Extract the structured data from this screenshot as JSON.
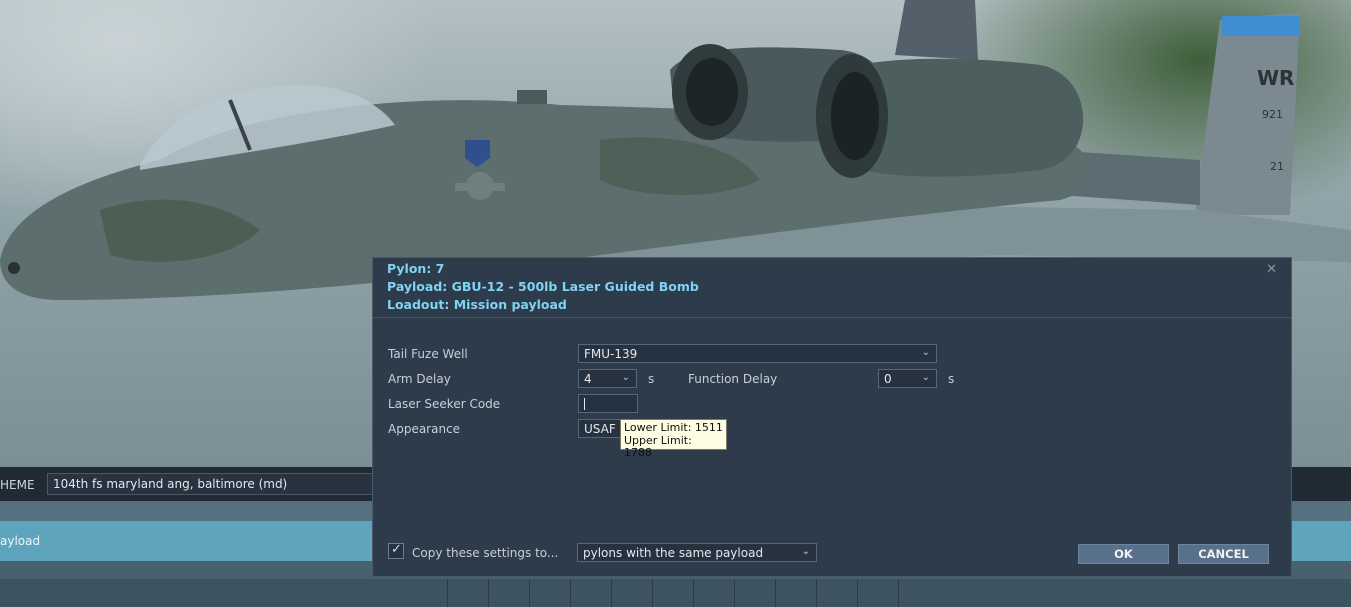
{
  "dialog": {
    "pylon": "Pylon: 7",
    "payload": "Payload: GBU-12 - 500lb Laser Guided Bomb",
    "loadout": "Loadout: Mission payload",
    "close_icon": "close-icon",
    "fields": {
      "tail_fuze_label": "Tail Fuze Well",
      "tail_fuze_value": "FMU-139",
      "arm_delay_label": "Arm Delay",
      "arm_delay_value": "4",
      "arm_delay_unit": "s",
      "function_delay_label": "Function Delay",
      "function_delay_value": "0",
      "function_delay_unit": "s",
      "laser_code_label": "Laser Seeker Code",
      "laser_code_value": "",
      "appearance_label": "Appearance",
      "appearance_value": "USAF"
    },
    "tooltip": {
      "lower": "Lower Limit: 1511",
      "upper": "Upper Limit: 1788"
    },
    "copy": {
      "checked": true,
      "label": "Copy these settings to...",
      "target": "pylons with the same payload"
    },
    "buttons": {
      "ok": "OK",
      "cancel": "CANCEL"
    }
  },
  "background": {
    "scheme_label": "HEME",
    "scheme_value": "104th fs maryland ang, baltimore (md)",
    "payload_row_label": "ayload",
    "tail_code": "WR",
    "serial": "921",
    "tail_small": "21"
  },
  "colors": {
    "accent": "#7fd3f3",
    "dialog_bg": "#2d3b4b",
    "payload_bar": "#5fa4bd",
    "button": "#58708a"
  }
}
